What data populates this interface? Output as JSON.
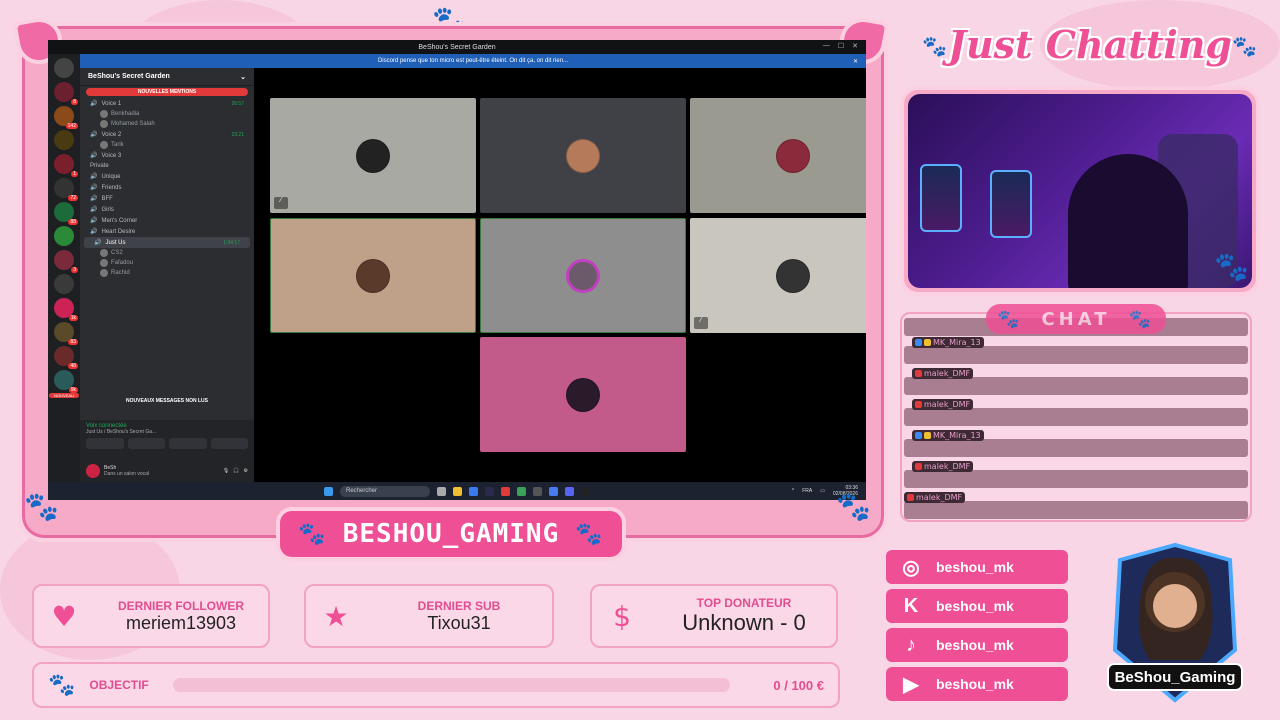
{
  "stream": {
    "title": "Just Chatting",
    "channel_name": "BESHOU_GAMING",
    "chat_label": "CHAT",
    "logo_text": "BeShou_Gaming"
  },
  "discord": {
    "window_title": "BeShou's Secret Garden",
    "banner_text": "Discord pense que ton micro est peut-être éteint. On dit ça, on dit rien...",
    "guild_name": "BeShou's Secret Garden",
    "new_mentions": "NOUVELLES MENTIONS",
    "new_messages": "NOUVEAUX MESSAGES NON LUS",
    "server_badge_new": "NOUVEAU",
    "channels": [
      {
        "label": "Voice 1",
        "time": "26:57"
      },
      {
        "label": "Benkhadia",
        "time": ""
      },
      {
        "label": "Mohamed Salah",
        "time": ""
      },
      {
        "label": "Voice 2",
        "time": "23:21"
      },
      {
        "label": "Tarik",
        "time": ""
      },
      {
        "label": "Voice 3",
        "time": ""
      },
      {
        "label": "Private",
        "time": ""
      },
      {
        "label": "Unique",
        "time": ""
      },
      {
        "label": "Friends",
        "time": ""
      },
      {
        "label": "BFF",
        "time": ""
      },
      {
        "label": "Girls",
        "time": ""
      },
      {
        "label": "Men's Corner",
        "time": ""
      },
      {
        "label": "Heart Desire",
        "time": ""
      },
      {
        "label": "Just Us",
        "time": "1:34:17"
      },
      {
        "label": "CS2",
        "time": ""
      },
      {
        "label": "Fafadou",
        "time": ""
      },
      {
        "label": "Rachid",
        "time": ""
      }
    ],
    "voice_connected": "Voix connectée",
    "voice_location": "Just Us / BeShou's Secret Ga...",
    "user_name": "BeSh",
    "user_status": "Dans un salon vocal",
    "taskbar_search": "Rechercher",
    "tray_lang": "FRA",
    "tray_time": "03:36",
    "tray_date": "02/08/2026"
  },
  "stats": {
    "follower_label": "DERNIER FOLLOWER",
    "follower_value": "meriem13903",
    "sub_label": "DERNIER SUB",
    "sub_value": "Tixou31",
    "donor_label": "TOP DONATEUR",
    "donor_value": "Unknown - 0",
    "goal_label": "OBJECTIF",
    "goal_value": "0 / 100 €",
    "goal_progress": 0
  },
  "chat": {
    "messages": [
      {
        "user": ""
      },
      {
        "user": "MK_Mira_13"
      },
      {
        "user": "malek_DMF"
      },
      {
        "user": "malek_DMF"
      },
      {
        "user": "MK_Mira_13"
      },
      {
        "user": "malek_DMF"
      },
      {
        "user": "malek_DMF"
      }
    ]
  },
  "socials": [
    {
      "icon": "instagram-icon",
      "handle": "beshou_mk"
    },
    {
      "icon": "kick-icon",
      "handle": "beshou_mk"
    },
    {
      "icon": "tiktok-icon",
      "handle": "beshou_mk"
    },
    {
      "icon": "youtube-icon",
      "handle": "beshou_mk"
    }
  ],
  "colors": {
    "accent": "#ef4f95",
    "background": "#f9d6e5",
    "discord_bg": "#1e1f22",
    "online_green": "#23a55a"
  }
}
